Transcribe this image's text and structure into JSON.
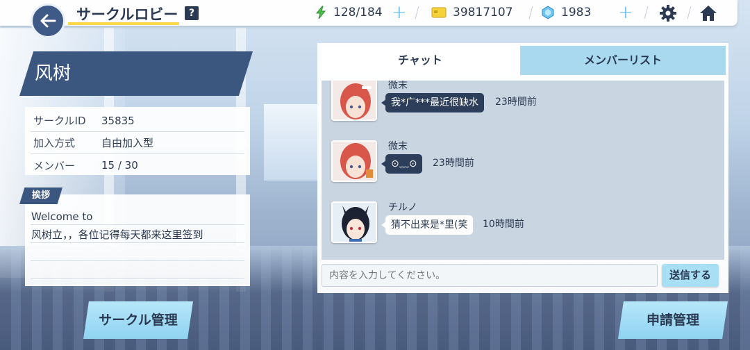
{
  "header": {
    "title": "サークルロビー",
    "help": "?",
    "stamina": "128/184",
    "credits": "39817107",
    "gems": "1983"
  },
  "circle": {
    "name": "风树",
    "info": [
      {
        "label": "サークルID",
        "value": "35835"
      },
      {
        "label": "加入方式",
        "value": "自由加入型"
      },
      {
        "label": "メンバー",
        "value": "15 / 30"
      }
    ],
    "greeting_tag": "挨拶",
    "greeting_lines": [
      "Welcome to",
      "风树立，，各位记得每天都来这里签到"
    ]
  },
  "chat": {
    "tabs": [
      "チャット",
      "メンバーリスト"
    ],
    "messages": [
      {
        "sender": "微末",
        "text": "我*广***最近很缺水",
        "time": "23時間前",
        "style": "dark"
      },
      {
        "sender": "微末",
        "text": "⊙﹏⊙",
        "time": "23時間前",
        "style": "dark"
      },
      {
        "sender": "チルノ",
        "text": "猜不出来是*里(笑",
        "time": "10時間前",
        "style": "light"
      }
    ],
    "input_placeholder": "内容を入力してください。",
    "send_label": "送信する"
  },
  "buttons": {
    "circle_manage": "サークル管理",
    "apply_manage": "申請管理"
  }
}
